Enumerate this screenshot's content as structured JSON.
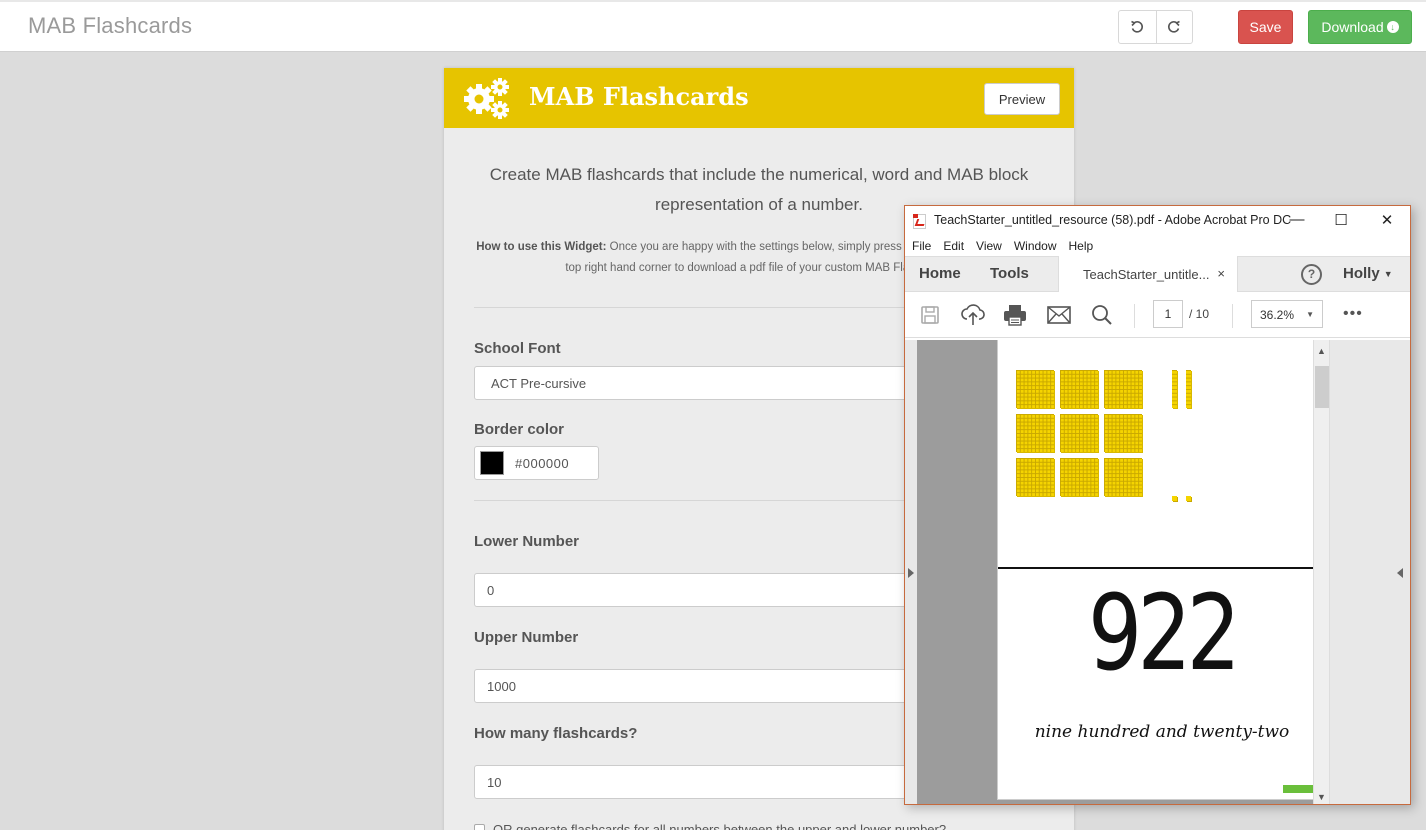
{
  "app": {
    "title": "MAB Flashcards",
    "undo_icon": "undo-icon",
    "redo_icon": "redo-icon",
    "save_label": "Save",
    "download_label": "Download",
    "download_icon": "arrow-circle-down-icon",
    "colors": {
      "save": "#d9534f",
      "download": "#5cb85c",
      "header": "#e6c400"
    }
  },
  "widget": {
    "title": "MAB Flashcards",
    "icon": "gears-icon",
    "preview_label": "Preview",
    "intro": "Create MAB flashcards that include the numerical, word and MAB block representation of a number.",
    "howto_label": "How to use this Widget:",
    "howto_text": " Once you are happy with the settings below, simply press the Download button in the top right hand corner to download a pdf file of your custom MAB Flashcards.",
    "fields": {
      "school_font": {
        "label": "School Font",
        "value": "ACT Pre-cursive"
      },
      "border_color": {
        "label": "Border color",
        "value": "#000000",
        "swatch": "#000000"
      },
      "lower_number": {
        "label": "Lower Number",
        "value": "0"
      },
      "upper_number": {
        "label": "Upper Number",
        "value": "1000"
      },
      "how_many": {
        "label": "How many flashcards?",
        "value": "10"
      },
      "all_numbers": {
        "label": "OR generate flashcards for all numbers between the upper and lower number?",
        "checked": false
      }
    }
  },
  "acrobat": {
    "window_title": "TeachStarter_untitled_resource (58).pdf - Adobe Acrobat Pro DC",
    "minimize": "—",
    "maximize": "☐",
    "close": "✕",
    "menu": [
      "File",
      "Edit",
      "View",
      "Window",
      "Help"
    ],
    "tabs": {
      "home": "Home",
      "tools": "Tools",
      "doc": "TeachStarter_untitle...",
      "doc_close": "×"
    },
    "help": "?",
    "user": "Holly",
    "toolbar": {
      "page_current": "1",
      "page_total": "/ 10",
      "zoom": "36.2%",
      "more": "•••"
    },
    "page": {
      "mab": {
        "hundreds": 9,
        "tens": 2,
        "ones": 2
      },
      "number": "922",
      "words": "nine hundred and twenty-two"
    }
  }
}
